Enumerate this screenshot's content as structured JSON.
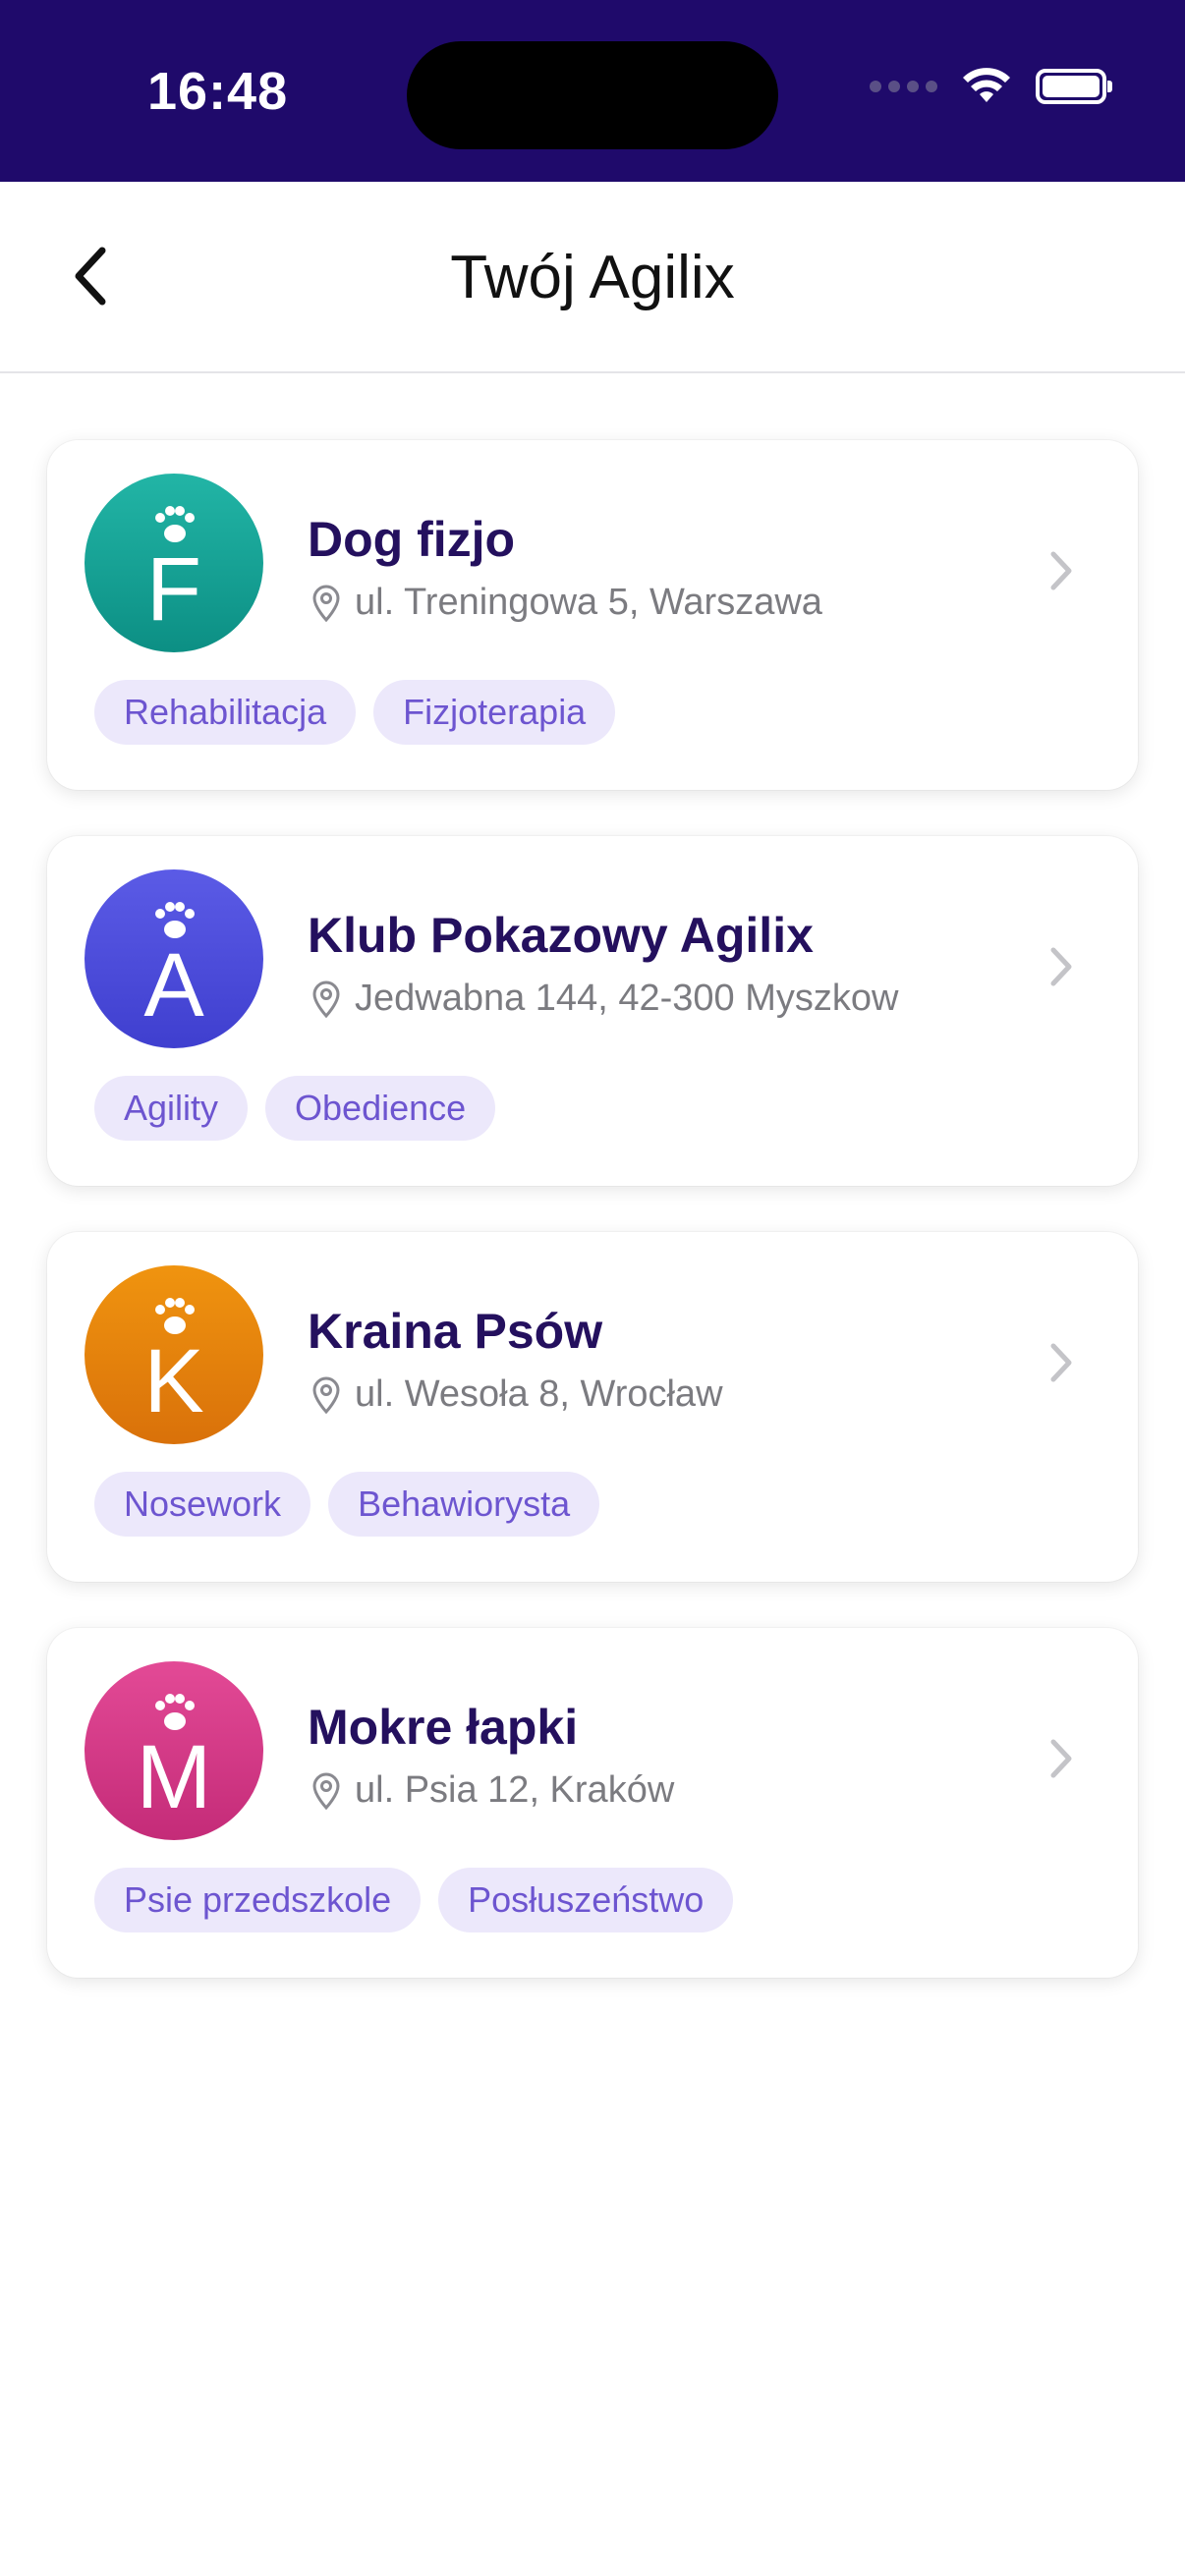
{
  "status_bar": {
    "time": "16:48"
  },
  "nav": {
    "title": "Twój Agilix"
  },
  "places": [
    {
      "initial": "F",
      "name": "Dog fizjo",
      "address": "ul. Treningowa 5, Warszawa",
      "color_top": "#22b5a6",
      "color_bottom": "#0c8f84",
      "tags": [
        "Rehabilitacja",
        "Fizjoterapia"
      ]
    },
    {
      "initial": "A",
      "name": "Klub Pokazowy Agilix",
      "address": "Jedwabna 144, 42-300 Myszkow",
      "color_top": "#5b5be6",
      "color_bottom": "#3f3fcf",
      "tags": [
        "Agility",
        "Obedience"
      ]
    },
    {
      "initial": "K",
      "name": "Kraina Psów",
      "address": "ul. Wesoła 8, Wrocław",
      "color_top": "#f0940f",
      "color_bottom": "#d9710a",
      "tags": [
        "Nosework",
        "Behawiorysta"
      ]
    },
    {
      "initial": "M",
      "name": "Mokre łapki",
      "address": "ul. Psia 12, Kraków",
      "color_top": "#e34a96",
      "color_bottom": "#c42b78",
      "tags": [
        "Psie przedszkole",
        "Posłuszeństwo"
      ]
    }
  ]
}
